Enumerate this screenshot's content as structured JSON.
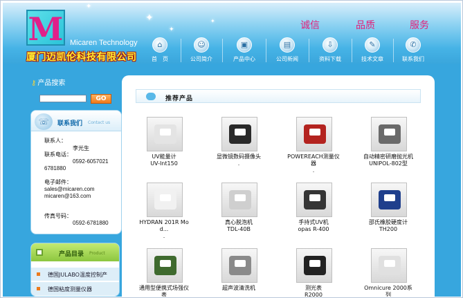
{
  "header": {
    "logo_letter": "M",
    "logo_en": "Micaren Technology",
    "logo_cn": "厦门迈凯伦科技有限公司",
    "slogans": [
      "诚信",
      "品质",
      "服务"
    ],
    "nav": [
      {
        "label": "首　页",
        "icon": "home-icon"
      },
      {
        "label": "公司简介",
        "icon": "people-icon"
      },
      {
        "label": "产品中心",
        "icon": "box-icon"
      },
      {
        "label": "公司新闻",
        "icon": "news-icon"
      },
      {
        "label": "资料下载",
        "icon": "download-icon"
      },
      {
        "label": "技术文章",
        "icon": "article-icon"
      },
      {
        "label": "联系我们",
        "icon": "contact-icon"
      }
    ]
  },
  "sidebar": {
    "search_title": "产品搜索",
    "go_label": "GO",
    "contact": {
      "title": "联系我们",
      "subtitle": "Contact us",
      "lines": [
        "联系人：",
        "李光生",
        "联系电话：",
        "0592-6057021",
        "6781880",
        "电子邮件：",
        "sales@micaren.com",
        "micaren@163.com",
        "传真号码：",
        "0592-6781880"
      ]
    },
    "catalog": {
      "title": "产品目录",
      "subtitle": "Product",
      "items": [
        "德国JULABO温度控制产",
        "德国粘度测量仪器"
      ]
    }
  },
  "content": {
    "title": "推荐产品",
    "products": [
      {
        "name": "UV能量计\nUV-Int150",
        "color": "#e4e4e4"
      },
      {
        "name": "显微镜数码摄像头\n.",
        "color": "#2a2a2a"
      },
      {
        "name": "POWEREACH测量仪\n器\n.",
        "color": "#b3231f"
      },
      {
        "name": "自动精密研磨抛光机\nUNIPOL-802型",
        "color": "#6a6a6a"
      },
      {
        "name": "HYDRAN 201R Mo\nd...\n.",
        "color": "#f1f1f1"
      },
      {
        "name": "真心脱泡机\nTDL-40B",
        "color": "#cfcfcf"
      },
      {
        "name": "手持式UV机\nopas R-400",
        "color": "#353535"
      },
      {
        "name": "邵氏橡胶硬度计\nTH200",
        "color": "#1f3f8c"
      },
      {
        "name": "通用型便携式场强仪\n表",
        "color": "#3f6a2e"
      },
      {
        "name": "超声波清洗机",
        "color": "#8a8a8a"
      },
      {
        "name": "测光表\nR2000",
        "color": "#222222"
      },
      {
        "name": "Omnicure 2000系\n列",
        "color": "#e0e0e0"
      }
    ]
  }
}
